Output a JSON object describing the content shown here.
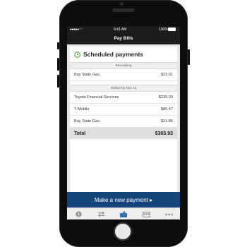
{
  "status": {
    "time": "9:41 AM",
    "battery": "100%"
  },
  "header": {
    "title": "Pay Bills"
  },
  "card": {
    "title": "Scheduled payments",
    "icon": "clock-icon"
  },
  "sections": [
    {
      "label": "Processing",
      "items": [
        {
          "name": "Bay State Gas",
          "amount": "$23.61"
        }
      ]
    },
    {
      "label": "Deliver by Nov 14",
      "items": [
        {
          "name": "Toyota Financial Services",
          "amount": "$235.00"
        },
        {
          "name": "T-Mobile",
          "amount": "$85.47"
        },
        {
          "name": "Bay State Gas",
          "amount": "$21.85"
        }
      ]
    }
  ],
  "total": {
    "label": "Total",
    "amount": "$365.93"
  },
  "action": {
    "label": "Make a new payment ▸"
  },
  "tabs": [
    "dollar-icon",
    "transfer-icon",
    "deposit-icon",
    "card-icon",
    "more-icon"
  ],
  "colors": {
    "accent": "#15467a",
    "clock": "#5aa83a",
    "phone": "#0d0d0d"
  }
}
